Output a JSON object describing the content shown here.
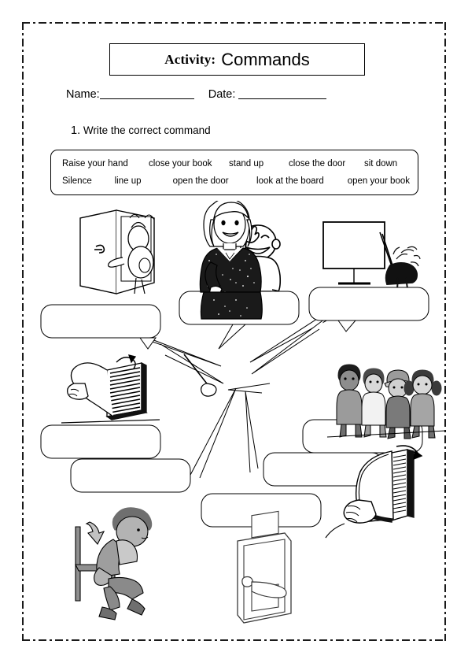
{
  "worksheet": {
    "title_label": "Activity:",
    "title_topic": "Commands",
    "name_label": "Name:",
    "date_label": "Date:",
    "instruction_number": "1.",
    "instruction_text": "Write the correct command"
  },
  "word_bank": {
    "row1": [
      "Raise your hand",
      "close your book",
      "stand up",
      "close the door",
      "sit down"
    ],
    "row2": [
      "Silence",
      "line up",
      "open the door",
      "look at the board",
      "open your book"
    ]
  },
  "answer_bubbles": [
    {
      "id": "bubble-1",
      "value": ""
    },
    {
      "id": "bubble-2",
      "value": ""
    },
    {
      "id": "bubble-3",
      "value": ""
    },
    {
      "id": "bubble-4",
      "value": ""
    },
    {
      "id": "bubble-5",
      "value": ""
    },
    {
      "id": "bubble-6",
      "value": ""
    },
    {
      "id": "bubble-7",
      "value": ""
    },
    {
      "id": "bubble-8",
      "value": ""
    }
  ],
  "illustrations": [
    {
      "id": "open-the-door-illustration",
      "position": "top-left"
    },
    {
      "id": "raise-your-hand-illustration",
      "position": "top-center"
    },
    {
      "id": "look-at-the-board-illustration",
      "position": "top-right"
    },
    {
      "id": "open-your-book-illustration",
      "position": "middle-left"
    },
    {
      "id": "teacher-illustration",
      "position": "center"
    },
    {
      "id": "line-up-illustration",
      "position": "middle-right"
    },
    {
      "id": "close-your-book-illustration",
      "position": "bottom-right"
    },
    {
      "id": "sit-down-illustration",
      "position": "bottom-left"
    },
    {
      "id": "close-the-door-illustration",
      "position": "bottom-center"
    }
  ],
  "colors": {
    "ink": "#000000",
    "paper": "#ffffff",
    "grey_fill": "#9a9a9a",
    "grey_light": "#c8c8c8",
    "grey_dark": "#5a5a5a"
  }
}
